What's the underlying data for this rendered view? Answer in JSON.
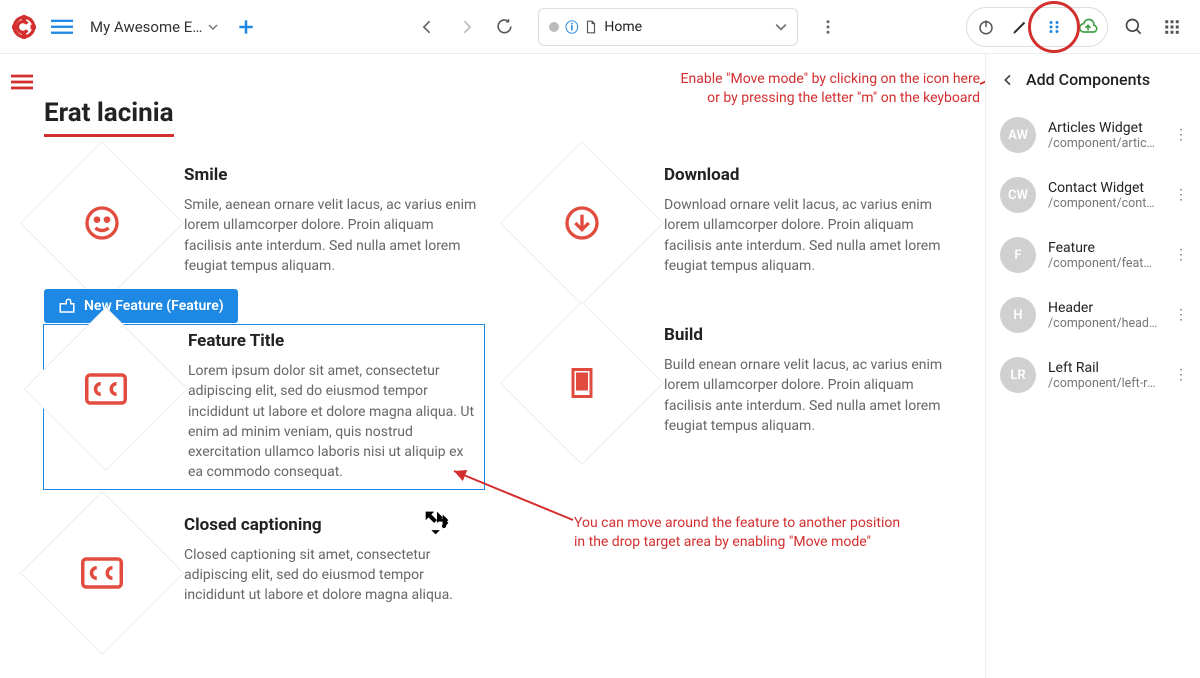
{
  "toolbar": {
    "project_name": "My Awesome E…",
    "location_label": "Home"
  },
  "annotations": {
    "move_mode_hint": "Enable \"Move mode\" by clicking on the icon here or by pressing the letter \"m\" on the keyboard",
    "drag_hint": "You can move around the feature to another position in the drop target area by enabling \"Move mode\""
  },
  "page": {
    "title": "Erat lacinia",
    "new_component_badge": "New Feature (Feature)",
    "features": [
      {
        "title": "Smile",
        "body": "Smile, aenean ornare velit lacus, ac varius enim lorem ullamcorper dolore. Proin aliquam facilisis ante interdum. Sed nulla amet lorem feugiat tempus aliquam."
      },
      {
        "title": "Download",
        "body": "Download ornare velit lacus, ac varius enim lorem ullamcorper dolore. Proin aliquam facilisis ante interdum. Sed nulla amet lorem feugiat tempus aliquam."
      },
      {
        "title": "Feature Title",
        "body": "Lorem ipsum dolor sit amet, consectetur adipiscing elit, sed do eiusmod tempor incididunt ut labore et dolore magna aliqua. Ut enim ad minim veniam, quis nostrud exercitation ullamco laboris nisi ut aliquip ex ea commodo consequat."
      },
      {
        "title": "Build",
        "body": "Build enean ornare velit lacus, ac varius enim lorem ullamcorper dolore. Proin aliquam facilisis ante interdum. Sed nulla amet lorem feugiat tempus aliquam."
      },
      {
        "title": "Closed captioning",
        "body": "Closed captioning sit amet, consectetur adipiscing elit, sed do eiusmod tempor incididunt ut labore et dolore magna aliqua."
      }
    ]
  },
  "panel": {
    "title": "Add Components",
    "items": [
      {
        "initials": "AW",
        "name": "Articles Widget",
        "path": "/component/artic…"
      },
      {
        "initials": "CW",
        "name": "Contact Widget",
        "path": "/component/cont…"
      },
      {
        "initials": "F",
        "name": "Feature",
        "path": "/component/feature"
      },
      {
        "initials": "H",
        "name": "Header",
        "path": "/component/header"
      },
      {
        "initials": "LR",
        "name": "Left Rail",
        "path": "/component/left-rail"
      }
    ]
  }
}
